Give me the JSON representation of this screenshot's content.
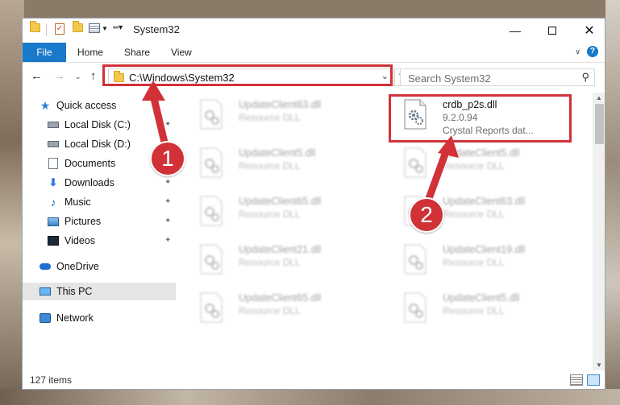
{
  "window": {
    "title": "System32",
    "minimize_icon": "minimize-icon",
    "maximize_icon": "maximize-icon",
    "close_icon": "close-icon"
  },
  "ribbon": {
    "tabs": [
      "File",
      "Home",
      "Share",
      "View"
    ]
  },
  "nav": {
    "back_icon": "arrow-left-icon",
    "forward_icon": "arrow-right-icon",
    "up_icon": "arrow-up-icon"
  },
  "address": {
    "path": "C:\\Windows\\System32"
  },
  "search": {
    "placeholder": "Search System32"
  },
  "sidebar": {
    "items": [
      {
        "label": "Quick access",
        "icon": "star-icon",
        "pinned": false
      },
      {
        "label": "Local Disk (C:)",
        "icon": "drive-icon",
        "pinned": true
      },
      {
        "label": "Local Disk (D:)",
        "icon": "drive-icon",
        "pinned": false
      },
      {
        "label": "Documents",
        "icon": "documents-icon",
        "pinned": true
      },
      {
        "label": "Downloads",
        "icon": "downloads-icon",
        "pinned": true
      },
      {
        "label": "Music",
        "icon": "music-icon",
        "pinned": true
      },
      {
        "label": "Pictures",
        "icon": "pictures-icon",
        "pinned": true
      },
      {
        "label": "Videos",
        "icon": "videos-icon",
        "pinned": true
      },
      {
        "label": "OneDrive",
        "icon": "cloud-icon",
        "pinned": false
      },
      {
        "label": "This PC",
        "icon": "computer-icon",
        "pinned": false,
        "selected": true
      },
      {
        "label": "Network",
        "icon": "network-icon",
        "pinned": false
      }
    ]
  },
  "files": [
    {
      "name": "UpdateClient63.dll",
      "type": "Resource DLL"
    },
    {
      "name": "crdb_p2s.dll",
      "version": "9.2.0.94",
      "description": "Crystal Reports dat..."
    },
    {
      "name": "UpdateClient5.dll",
      "type": "Resource DLL"
    },
    {
      "name": "UpdateClient5.dll",
      "type": "Resource DLL"
    },
    {
      "name": "UpdateClient65.dll",
      "type": "Resource DLL"
    },
    {
      "name": "UpdateClient63.dll",
      "type": "Resource DLL"
    },
    {
      "name": "UpdateClient21.dll",
      "type": "Resource DLL"
    },
    {
      "name": "UpdateClient19.dll",
      "type": "Resource DLL"
    },
    {
      "name": "UpdateClient65.dll",
      "type": "Resource DLL"
    },
    {
      "name": "UpdateClient5.dll",
      "type": "Resource DLL"
    }
  ],
  "status": {
    "item_count": "127 items"
  },
  "annotations": {
    "step1": "1",
    "step2": "2",
    "color": "#d03238"
  }
}
